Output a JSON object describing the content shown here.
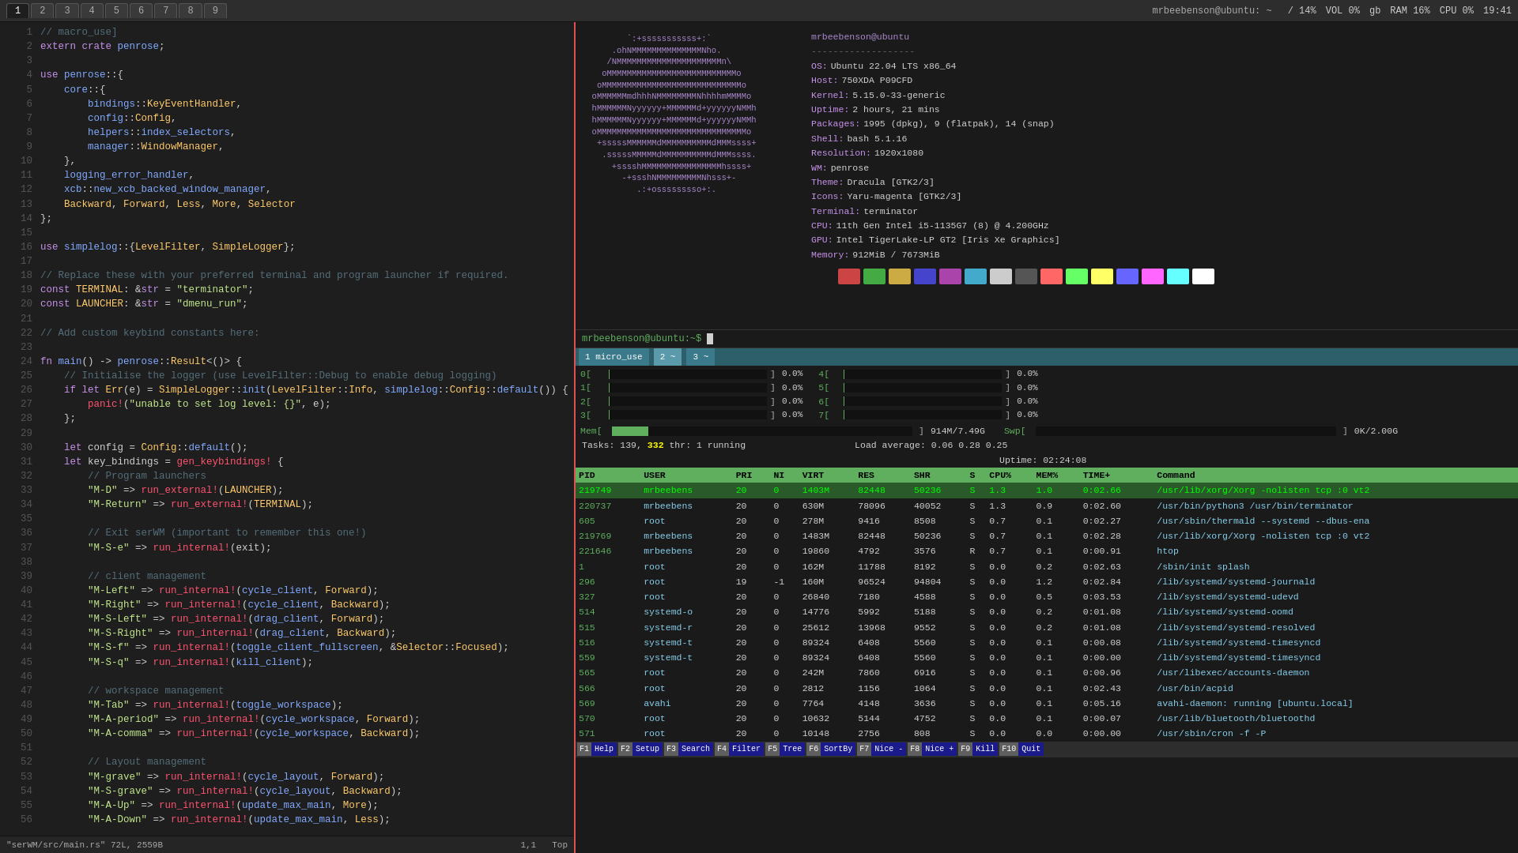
{
  "tabs": {
    "numbers": [
      "1",
      "2",
      "3",
      "4",
      "5",
      "6",
      "7",
      "8",
      "9"
    ],
    "active_tab": "1",
    "title": "mrbeebenson@ubuntu: ~"
  },
  "top_stats": {
    "percent": "/ 14%",
    "vol": "VOL 0%",
    "gb": "gb",
    "ram": "RAM 16%",
    "cpu": "CPU 0%",
    "time": "19:41"
  },
  "code": {
    "file": "\"serWM/src/main.rs\" 72L, 2559B",
    "position": "1,1",
    "scroll": "Top",
    "lines": [
      {
        "n": "",
        "text": "// macro_use]"
      },
      {
        "n": "",
        "text": "extern crate penrose;"
      },
      {
        "n": "",
        "text": ""
      },
      {
        "n": "",
        "text": "use penrose::{"
      },
      {
        "n": "",
        "text": "    core::{"
      },
      {
        "n": "",
        "text": "        bindings::KeyEventHandler,"
      },
      {
        "n": "",
        "text": "        config::Config,"
      },
      {
        "n": "",
        "text": "        helpers::index_selectors,"
      },
      {
        "n": "",
        "text": "        manager::WindowManager,"
      },
      {
        "n": "",
        "text": "    },"
      },
      {
        "n": "",
        "text": "    logging_error_handler,"
      },
      {
        "n": "",
        "text": "    xcb::new_xcb_backed_window_manager,"
      },
      {
        "n": "",
        "text": "    Backward, Forward, Less, More, Selector"
      },
      {
        "n": "",
        "text": "};"
      },
      {
        "n": "",
        "text": ""
      },
      {
        "n": "",
        "text": "use simplelog::{LevelFilter, SimpleLogger};"
      },
      {
        "n": "",
        "text": ""
      },
      {
        "n": "",
        "text": "// Replace these with your preferred terminal and program launcher if required."
      },
      {
        "n": "",
        "text": "const TERMINAL: &str = \"terminator\";"
      },
      {
        "n": "",
        "text": "const LAUNCHER: &str = \"dmenu_run\";"
      },
      {
        "n": "",
        "text": ""
      },
      {
        "n": "",
        "text": "// Add custom keybind constants here:"
      },
      {
        "n": "",
        "text": ""
      },
      {
        "n": "",
        "text": "fn main() -> penrose::Result<()> {"
      },
      {
        "n": "",
        "text": "    // Initialise the logger (use LevelFilter::Debug to enable debug logging)"
      },
      {
        "n": "",
        "text": "    if let Err(e) = SimpleLogger::init(LevelFilter::Info, simplelog::Config::default()) {"
      },
      {
        "n": "",
        "text": "        panic!(\"unable to set log level: {}\", e);"
      },
      {
        "n": "",
        "text": "    };"
      },
      {
        "n": "",
        "text": ""
      },
      {
        "n": "",
        "text": "    let config = Config::default();"
      },
      {
        "n": "",
        "text": "    let key_bindings = gen_keybindings! {"
      },
      {
        "n": "",
        "text": "        // Program launchers"
      },
      {
        "n": "",
        "text": "        \"M-D\" => run_external!(LAUNCHER);"
      },
      {
        "n": "",
        "text": "        \"M-Return\" => run_external!(TERMINAL);"
      },
      {
        "n": "",
        "text": ""
      },
      {
        "n": "",
        "text": "        // Exit serWM (important to remember this one!)"
      },
      {
        "n": "",
        "text": "        \"M-S-e\" => run_internal!(exit);"
      },
      {
        "n": "",
        "text": ""
      },
      {
        "n": "",
        "text": "        // client management"
      },
      {
        "n": "",
        "text": "        \"M-Left\" => run_internal!(cycle_client, Forward);"
      },
      {
        "n": "",
        "text": "        \"M-Right\" => run_internal!(cycle_client, Backward);"
      },
      {
        "n": "",
        "text": "        \"M-S-Left\" => run_internal!(drag_client, Forward);"
      },
      {
        "n": "",
        "text": "        \"M-S-Right\" => run_internal!(drag_client, Backward);"
      },
      {
        "n": "",
        "text": "        \"M-S-f\" => run_internal!(toggle_client_fullscreen, &Selector::Focused);"
      },
      {
        "n": "",
        "text": "        \"M-S-q\" => run_internal!(kill_client);"
      },
      {
        "n": "",
        "text": ""
      },
      {
        "n": "",
        "text": "        // workspace management"
      },
      {
        "n": "",
        "text": "        \"M-Tab\" => run_internal!(toggle_workspace);"
      },
      {
        "n": "",
        "text": "        \"M-A-period\" => run_internal!(cycle_workspace, Forward);"
      },
      {
        "n": "",
        "text": "        \"M-A-comma\" => run_internal!(cycle_workspace, Backward);"
      },
      {
        "n": "",
        "text": ""
      },
      {
        "n": "",
        "text": "        // Layout management"
      },
      {
        "n": "",
        "text": "        \"M-grave\" => run_internal!(cycle_layout, Forward);"
      },
      {
        "n": "",
        "text": "        \"M-S-grave\" => run_internal!(cycle_layout, Backward);"
      },
      {
        "n": "",
        "text": "        \"M-A-Up\" => run_internal!(update_max_main, More);"
      },
      {
        "n": "",
        "text": "        \"M-A-Down\" => run_internal!(update_max_main, Less);"
      }
    ]
  },
  "sysinfo": {
    "username": "mrbeebenson@ubuntu",
    "separator": "-------------------",
    "fields": [
      {
        "label": "OS:",
        "value": "Ubuntu 22.04 LTS x86_64"
      },
      {
        "label": "Host:",
        "value": "750XDA P09CFD"
      },
      {
        "label": "Kernel:",
        "value": "5.15.0-33-generic"
      },
      {
        "label": "Uptime:",
        "value": "2 hours, 21 mins"
      },
      {
        "label": "Packages:",
        "value": "1995 (dpkg), 9 (flatpak), 14 (snap)"
      },
      {
        "label": "Shell:",
        "value": "bash 5.1.16"
      },
      {
        "label": "Resolution:",
        "value": "1920x1080"
      },
      {
        "label": "WM:",
        "value": "penrose"
      },
      {
        "label": "Theme:",
        "value": "Dracula [GTK2/3]"
      },
      {
        "label": "Icons:",
        "value": "Yaru-magenta [GTK2/3]"
      },
      {
        "label": "Terminal:",
        "value": "terminator"
      },
      {
        "label": "CPU:",
        "value": "11th Gen Intel i5-1135G7 (8) @ 4.200GHz"
      },
      {
        "label": "GPU:",
        "value": "Intel TigerLake-LP GT2 [Iris Xe Graphics]"
      },
      {
        "label": "Memory:",
        "value": "912MiB / 7673MiB"
      }
    ],
    "colors": [
      "#1a1a1a",
      "#cc4444",
      "#44aa44",
      "#ccaa44",
      "#4444cc",
      "#aa44aa",
      "#44aacc",
      "#cccccc",
      "#555555",
      "#ff6666",
      "#66ff66",
      "#ffff66",
      "#6666ff",
      "#ff66ff",
      "#66ffff",
      "#ffffff"
    ]
  },
  "terminal": {
    "prompt_user": "mrbeebenson@ubuntu",
    "prompt_host": "",
    "prompt_symbol": ":~$"
  },
  "htop": {
    "cpu_bars": [
      {
        "label": "0[",
        "pct": 0.5,
        "val": "0.0%"
      },
      {
        "label": "1[",
        "pct": 0.5,
        "val": "0.0%"
      },
      {
        "label": "2[",
        "pct": 0.5,
        "val": "0.0%"
      },
      {
        "label": "3[",
        "pct": 0.5,
        "val": "0.0%"
      },
      {
        "label": "4[",
        "pct": 0.5,
        "val": "0.0%"
      },
      {
        "label": "5[",
        "pct": 0.5,
        "val": "0.0%"
      },
      {
        "label": "6[",
        "pct": 0.5,
        "val": "0.0%"
      },
      {
        "label": "7[",
        "pct": 0.5,
        "val": "0.0%"
      }
    ],
    "mem_bar": {
      "label": "Mem[",
      "pct": 12,
      "val": "914M/7.49G"
    },
    "swp_bar": {
      "label": "Swp[",
      "pct": 0,
      "val": "0K/2.00G"
    },
    "tasks": "Tasks: 139,",
    "thr": "332",
    "running": "thr: 1 running",
    "load": "Load average: 0.06 0.28 0.25",
    "uptime": "Uptime: 02:24:08",
    "table_headers": [
      "PID",
      "USER",
      "PRI",
      "NI",
      "VIRT",
      "RES",
      "SHR",
      "S",
      "CPU%",
      "MEM%",
      "TIME+",
      "Command"
    ],
    "processes": [
      {
        "pid": "219749",
        "user": "mrbeebens",
        "pri": "20",
        "ni": "0",
        "virt": "1403M",
        "res": "82448",
        "shr": "50236",
        "s": "S",
        "cpu": "1.3",
        "mem": "1.0",
        "time": "0:02.66",
        "cmd": "/usr/lib/xorg/Xorg -nolisten tcp :0 vt2",
        "highlight": true
      },
      {
        "pid": "220737",
        "user": "mrbeebens",
        "pri": "20",
        "ni": "0",
        "virt": "630M",
        "res": "78096",
        "shr": "40052",
        "s": "S",
        "cpu": "1.3",
        "mem": "0.9",
        "time": "0:02.60",
        "cmd": "/usr/bin/python3 /usr/bin/terminator"
      },
      {
        "pid": "605",
        "user": "root",
        "pri": "20",
        "ni": "0",
        "virt": "278M",
        "res": "9416",
        "shr": "8508",
        "s": "S",
        "cpu": "0.7",
        "mem": "0.1",
        "time": "0:02.27",
        "cmd": "/usr/sbin/thermald --systemd --dbus-ena"
      },
      {
        "pid": "219769",
        "user": "mrbeebens",
        "pri": "20",
        "ni": "0",
        "virt": "1483M",
        "res": "82448",
        "shr": "50236",
        "s": "S",
        "cpu": "0.7",
        "mem": "0.1",
        "time": "0:02.28",
        "cmd": "/usr/lib/xorg/Xorg -nolisten tcp :0 vt2"
      },
      {
        "pid": "221646",
        "user": "mrbeebens",
        "pri": "20",
        "ni": "0",
        "virt": "19860",
        "res": "4792",
        "shr": "3576",
        "s": "R",
        "cpu": "0.7",
        "mem": "0.1",
        "time": "0:00.91",
        "cmd": "htop"
      },
      {
        "pid": "1",
        "user": "root",
        "pri": "20",
        "ni": "0",
        "virt": "162M",
        "res": "11788",
        "shr": "8192",
        "s": "S",
        "cpu": "0.0",
        "mem": "0.2",
        "time": "0:02.63",
        "cmd": "/sbin/init splash"
      },
      {
        "pid": "296",
        "user": "root",
        "pri": "19",
        "ni": "-1",
        "virt": "160M",
        "res": "96524",
        "shr": "94804",
        "s": "S",
        "cpu": "0.0",
        "mem": "1.2",
        "time": "0:02.84",
        "cmd": "/lib/systemd/systemd-journald"
      },
      {
        "pid": "327",
        "user": "root",
        "pri": "20",
        "ni": "0",
        "virt": "26840",
        "res": "7180",
        "shr": "4588",
        "s": "S",
        "cpu": "0.0",
        "mem": "0.5",
        "time": "0:03.53",
        "cmd": "/lib/systemd/systemd-udevd"
      },
      {
        "pid": "514",
        "user": "systemd-o",
        "pri": "20",
        "ni": "0",
        "virt": "14776",
        "res": "5992",
        "shr": "5188",
        "s": "S",
        "cpu": "0.0",
        "mem": "0.2",
        "time": "0:01.08",
        "cmd": "/lib/systemd/systemd-oomd"
      },
      {
        "pid": "515",
        "user": "systemd-r",
        "pri": "20",
        "ni": "0",
        "virt": "25612",
        "res": "13968",
        "shr": "9552",
        "s": "S",
        "cpu": "0.0",
        "mem": "0.2",
        "time": "0:01.08",
        "cmd": "/lib/systemd/systemd-resolved"
      },
      {
        "pid": "516",
        "user": "systemd-t",
        "pri": "20",
        "ni": "0",
        "virt": "89324",
        "res": "6408",
        "shr": "5560",
        "s": "S",
        "cpu": "0.0",
        "mem": "0.1",
        "time": "0:00.08",
        "cmd": "/lib/systemd/systemd-timesyncd"
      },
      {
        "pid": "559",
        "user": "systemd-t",
        "pri": "20",
        "ni": "0",
        "virt": "89324",
        "res": "6408",
        "shr": "5560",
        "s": "S",
        "cpu": "0.0",
        "mem": "0.1",
        "time": "0:00.00",
        "cmd": "/lib/systemd/systemd-timesyncd"
      },
      {
        "pid": "565",
        "user": "root",
        "pri": "20",
        "ni": "0",
        "virt": "242M",
        "res": "7860",
        "shr": "6916",
        "s": "S",
        "cpu": "0.0",
        "mem": "0.1",
        "time": "0:00.96",
        "cmd": "/usr/libexec/accounts-daemon"
      },
      {
        "pid": "566",
        "user": "root",
        "pri": "20",
        "ni": "0",
        "virt": "2812",
        "res": "1156",
        "shr": "1064",
        "s": "S",
        "cpu": "0.0",
        "mem": "0.1",
        "time": "0:02.43",
        "cmd": "/usr/bin/acpid"
      },
      {
        "pid": "569",
        "user": "avahi",
        "pri": "20",
        "ni": "0",
        "virt": "7764",
        "res": "4148",
        "shr": "3636",
        "s": "S",
        "cpu": "0.0",
        "mem": "0.1",
        "time": "0:05.16",
        "cmd": "avahi-daemon: running [ubuntu.local]"
      },
      {
        "pid": "570",
        "user": "root",
        "pri": "20",
        "ni": "0",
        "virt": "10632",
        "res": "5144",
        "shr": "4752",
        "s": "S",
        "cpu": "0.0",
        "mem": "0.1",
        "time": "0:00.07",
        "cmd": "/usr/lib/bluetooth/bluetoothd"
      },
      {
        "pid": "571",
        "user": "root",
        "pri": "20",
        "ni": "0",
        "virt": "10148",
        "res": "2756",
        "shr": "808",
        "s": "S",
        "cpu": "0.0",
        "mem": "0.0",
        "time": "0:00.00",
        "cmd": "/usr/sbin/cron -f -P"
      }
    ],
    "footer": [
      {
        "fnum": "F1",
        "flabel": "Help"
      },
      {
        "fnum": "F2",
        "flabel": "Setup"
      },
      {
        "fnum": "F3",
        "flabel": "Search"
      },
      {
        "fnum": "F4",
        "flabel": "Filter"
      },
      {
        "fnum": "F5",
        "flabel": "Tree"
      },
      {
        "fnum": "F6",
        "flabel": "SortBy"
      },
      {
        "fnum": "F7",
        "flabel": "Nice -"
      },
      {
        "fnum": "F8",
        "flabel": "Nice +"
      },
      {
        "fnum": "F9",
        "flabel": "Kill"
      },
      {
        "fnum": "F10",
        "flabel": "Quit"
      }
    ]
  },
  "tmux": {
    "windows": [
      {
        "id": "1",
        "name": "micro_use",
        "active": false
      },
      {
        "id": "2",
        "name": "~",
        "active": true
      },
      {
        "id": "3",
        "name": "~",
        "active": false
      }
    ]
  }
}
